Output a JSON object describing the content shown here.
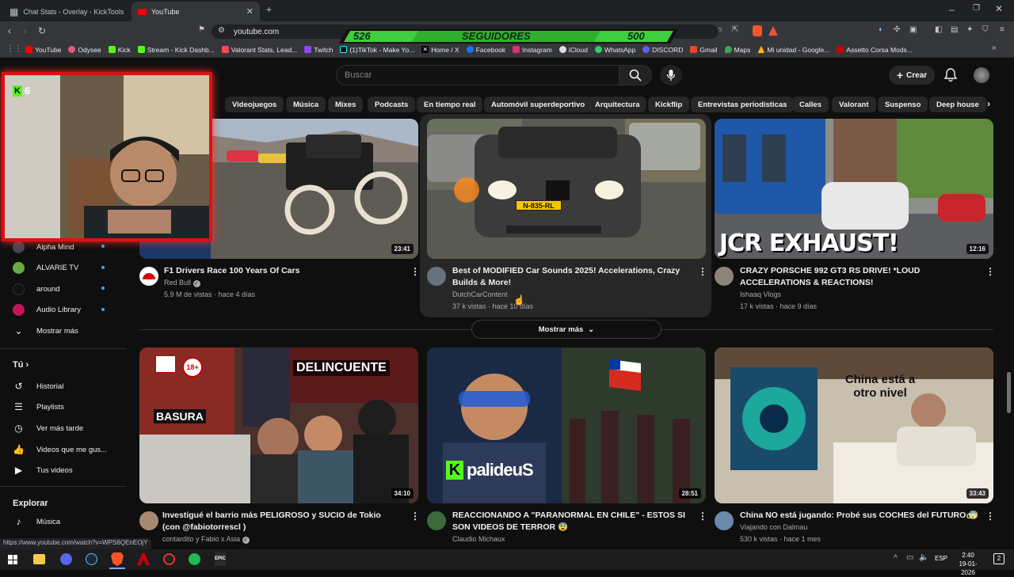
{
  "tabs": [
    {
      "label": "Chat Stats - Overlay - KickTools",
      "active": false
    },
    {
      "label": "YouTube",
      "active": true
    }
  ],
  "address": {
    "url": "youtube.com"
  },
  "bookmarks": [
    "YouTube",
    "Odysee",
    "Kick",
    "Stream - Kick Dashb...",
    "Valorant Stats, Lead...",
    "Twitch",
    "(1)TikTok - Make Yo...",
    "Home / X",
    "Facebook",
    "Instagram",
    "iCloud",
    "WhatsApp",
    "DISCORD",
    "Gmail",
    "Maps",
    "Mi unidad - Google...",
    "Assetto Corsa Mods..."
  ],
  "banner": {
    "current": "526",
    "label": "SEGUIDORES",
    "goal": "500"
  },
  "webcam": {
    "viewers": "6"
  },
  "search": {
    "placeholder": "Buscar"
  },
  "header": {
    "create_label": "Crear"
  },
  "chips": [
    "Videojuegos",
    "Música",
    "Mixes",
    "Podcasts",
    "En tiempo real",
    "Automóvil superdeportivo",
    "Arquitectura",
    "Kickflip",
    "Entrevistas periodísticas",
    "Calles",
    "Valorant",
    "Suspenso",
    "Deep house"
  ],
  "sidebar": {
    "subscriptions": [
      "Alpha Mind",
      "ALVARIE TV",
      "around",
      "Audio Library"
    ],
    "show_more": "Mostrar más",
    "you_title": "Tú",
    "you_items": [
      "Historial",
      "Playlists",
      "Ver más tarde",
      "Videos que me gus...",
      "Tus videos"
    ],
    "explore_title": "Explorar",
    "explore_items": [
      "Música"
    ]
  },
  "videos_row1": [
    {
      "title": "F1 Drivers Race 100 Years Of Cars",
      "channel": "Red Bull",
      "meta": "5.9 M de vistas · hace 4 días",
      "duration": "23:41",
      "verified": true
    },
    {
      "title": "Best of MODIFIED Car Sounds 2025! Accelerations, Crazy Builds & More!",
      "channel": "DutchCarContent",
      "meta": "37 k vistas · hace 10 días",
      "duration": "",
      "plate": "N-835-RL"
    },
    {
      "title": "CRAZY PORSCHE 992 GT3 RS DRIVE! *LOUD ACCELERATIONS & REACTIONS!",
      "channel": "Ishaaq Vlogs",
      "meta": "17 k vistas · hace 9 días",
      "duration": "12:16",
      "overlay": "JCR EXHAUST!"
    }
  ],
  "show_more_button": "Mostrar más",
  "videos_row2": [
    {
      "title": "Investigué el barrio más PELIGROSO y SUCIO de Tokio (con @fabiotorrescl )",
      "channel": "contardito y Fabio x Asia",
      "duration": "34:10",
      "overlay_top": "DELINCUENTE",
      "overlay_left": "BASURA",
      "badge": "18+",
      "verified": true
    },
    {
      "title": "REACCIONANDO A \"PARANORMAL EN CHILE\" - ESTOS SI SON VIDEOS DE TERROR 😨",
      "channel": "Claudio Michaux",
      "duration": "28:51",
      "overlay": "palideuS"
    },
    {
      "title": "China NO está jugando: Probé sus COCHES del FUTURO 😨",
      "channel": "Viajando con Dalmau",
      "meta": "530 k vistas · hace 1 mes",
      "duration": "33:43",
      "overlay": "China está a otro nivel",
      "cn": "CN"
    }
  ],
  "status_url": "https://www.youtube.com/watch?v=WPS6QEnEOjY",
  "taskbar": {
    "lang": "ESP",
    "time": "2:40",
    "date": "19-01-2026",
    "notif": "2"
  },
  "colors": {
    "bg": "#0f0f0f",
    "banner_green": "#3ecf3e",
    "cam_border": "#e01010"
  }
}
